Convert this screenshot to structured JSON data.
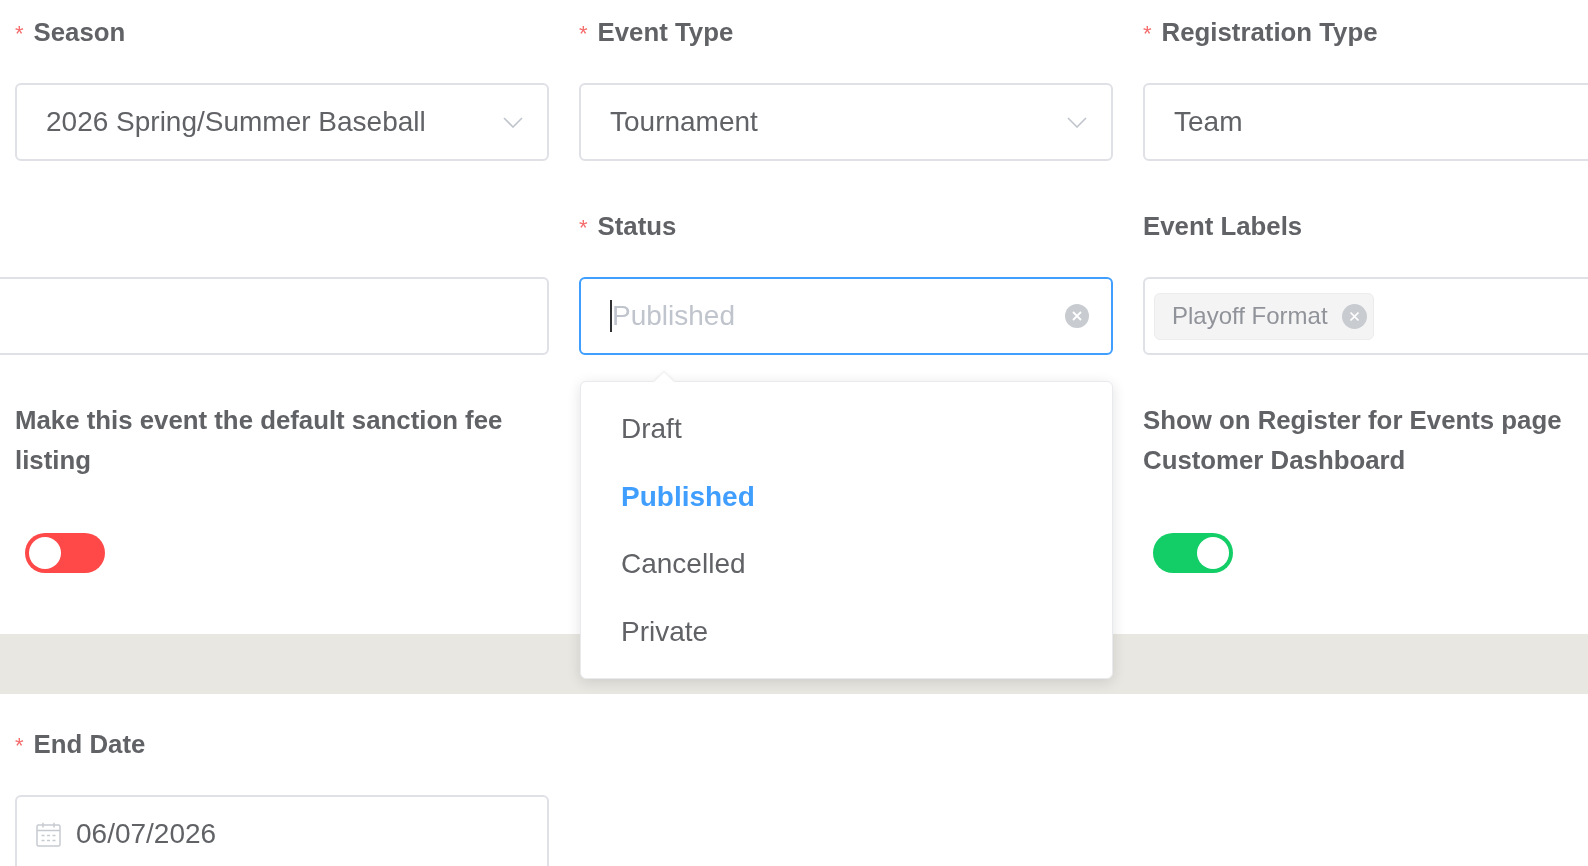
{
  "sections": [
    {
      "rows": [
        {
          "fields": [
            {
              "kind": "select",
              "required_marker": "*",
              "label": "Season",
              "value": "2026 Spring/Summer Baseball",
              "focused": false
            },
            {
              "kind": "select",
              "required_marker": "*",
              "label": "Event Type",
              "value": "Tournament",
              "focused": false
            },
            {
              "kind": "text",
              "required_marker": "*",
              "label": "Registration Type",
              "value": "Team",
              "focused": false
            }
          ]
        },
        {
          "fields": [
            {
              "kind": "text",
              "focused": false
            },
            {
              "kind": "select",
              "required_marker": "*",
              "label": "Status",
              "placeholder": "Published",
              "focused": true,
              "menu": [
                {
                  "label": "Draft",
                  "selected": false
                },
                {
                  "label": "Published",
                  "selected": true
                },
                {
                  "label": "Cancelled",
                  "selected": false
                },
                {
                  "label": "Private",
                  "selected": false
                }
              ]
            },
            {
              "kind": "tags",
              "label": "Event Labels",
              "tags": [
                "Playoff Format"
              ],
              "focused": false
            }
          ]
        },
        {
          "fields": [
            {
              "kind": "switch",
              "label": "Make this event the default sanction fee listing",
              "on": false
            },
            {
              "kind": "switch",
              "label": "Show on Register for Events page Customer Dashboard",
              "on": true
            }
          ]
        }
      ]
    },
    {
      "rows": [
        {
          "fields": [
            {
              "kind": "date",
              "required_marker": "*",
              "label": "End Date",
              "value": "06/07/2026",
              "focused": false
            }
          ]
        }
      ]
    }
  ]
}
